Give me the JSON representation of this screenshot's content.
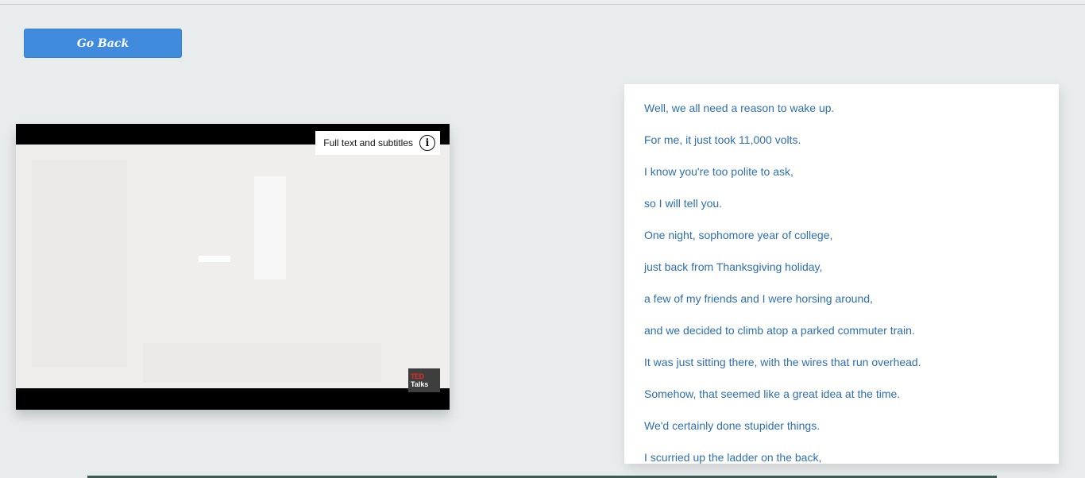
{
  "header": {
    "go_back_label": "Go Back"
  },
  "video": {
    "info_label": "Full text and subtitles",
    "info_icon": "i",
    "logo_ted": "TED",
    "logo_talks": "Talks"
  },
  "transcript": {
    "lines": [
      "Well, we all need a reason to wake up.",
      "For me, it just took 11,000 volts.",
      "I know you're too polite to ask,",
      "so I will tell you.",
      "One night, sophomore year of college,",
      "just back from Thanksgiving holiday,",
      "a few of my friends and I were horsing around,",
      "and we decided to climb atop a parked commuter train.",
      "It was just sitting there, with the wires that run overhead.",
      "Somehow, that seemed like a great idea at the time.",
      "We'd certainly done stupider things.",
      "I scurried up the ladder on the back,"
    ]
  },
  "colors": {
    "accent": "#418bdf",
    "transcript_text": "#2d6fb0",
    "background": "#e9eced"
  }
}
